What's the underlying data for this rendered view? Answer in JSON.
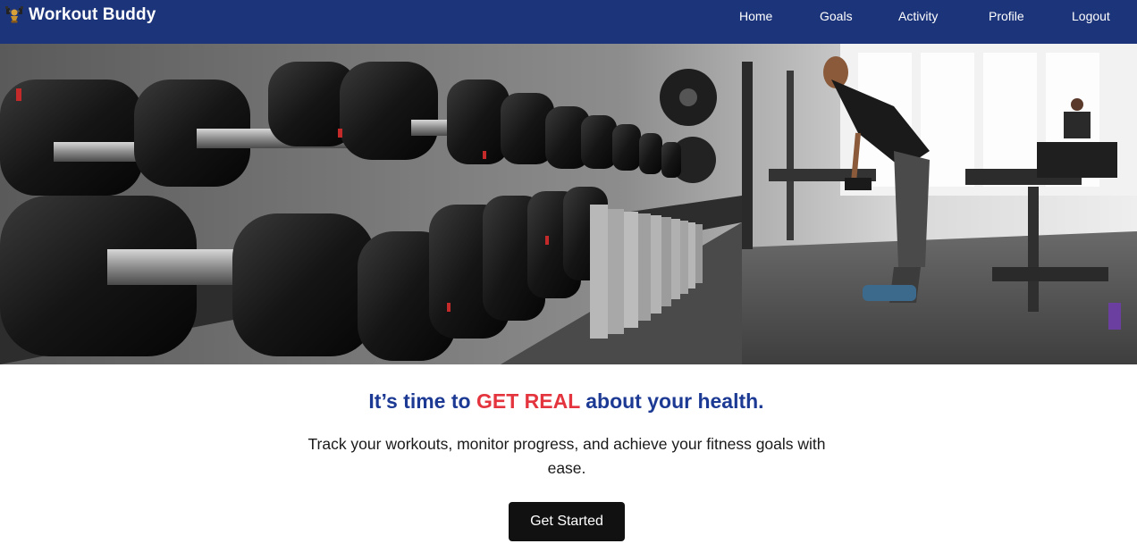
{
  "app": {
    "brand_name": "Workout Buddy",
    "brand_icon": "dumbbell-trophy-icon"
  },
  "nav": {
    "items": [
      {
        "label": "Home"
      },
      {
        "label": "Goals"
      },
      {
        "label": "Activity"
      },
      {
        "label": "Profile"
      },
      {
        "label": "Logout"
      }
    ]
  },
  "hero": {
    "image_subject": "gym-dumbbell-rack-photo"
  },
  "content": {
    "headline_before": "It’s time to ",
    "headline_accent": "GET REAL",
    "headline_after": " about your health.",
    "subtext": "Track your workouts, monitor progress, and achieve your fitness goals with ease.",
    "cta_label": "Get Started"
  },
  "colors": {
    "navbar_bg": "#1c3479",
    "headline": "#1c3a94",
    "accent": "#e4343e",
    "cta_bg": "#111111"
  }
}
